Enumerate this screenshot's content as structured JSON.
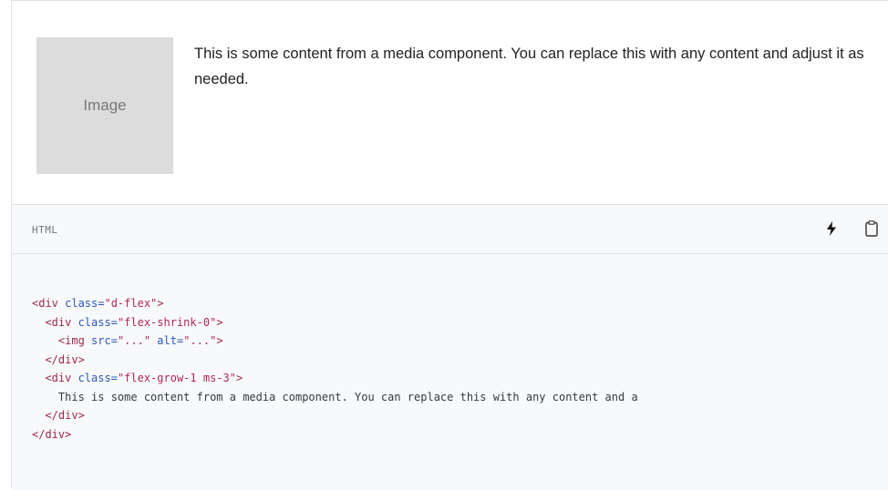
{
  "preview": {
    "image_placeholder": "Image",
    "media_text": "This is some content from a media component. You can replace this with any content and adjust it as needed."
  },
  "code_header": {
    "language": "HTML",
    "icons": [
      "lightning-icon",
      "clipboard-icon"
    ]
  },
  "code_lines": {
    "l1_open": "<div",
    "l1_attr": " class=",
    "l1_val": "\"d-flex\"",
    "l1_close": ">",
    "l2_indent": "  ",
    "l2_open": "<div",
    "l2_attr": " class=",
    "l2_val": "\"flex-shrink-0\"",
    "l2_close": ">",
    "l3_indent": "    ",
    "l3_open": "<img",
    "l3_attr1": " src=",
    "l3_val1": "\"...\"",
    "l3_attr2": " alt=",
    "l3_val2": "\"...\"",
    "l3_close": ">",
    "l4_indent": "  ",
    "l4_tag": "</div>",
    "l5_indent": "  ",
    "l5_open": "<div",
    "l5_attr": " class=",
    "l5_val": "\"flex-grow-1 ms-3\"",
    "l5_close": ">",
    "l6_text": "    This is some content from a media component. You can replace this with any content and a",
    "l7_indent": "  ",
    "l7_tag": "</div>",
    "l8_tag": "</div>"
  }
}
